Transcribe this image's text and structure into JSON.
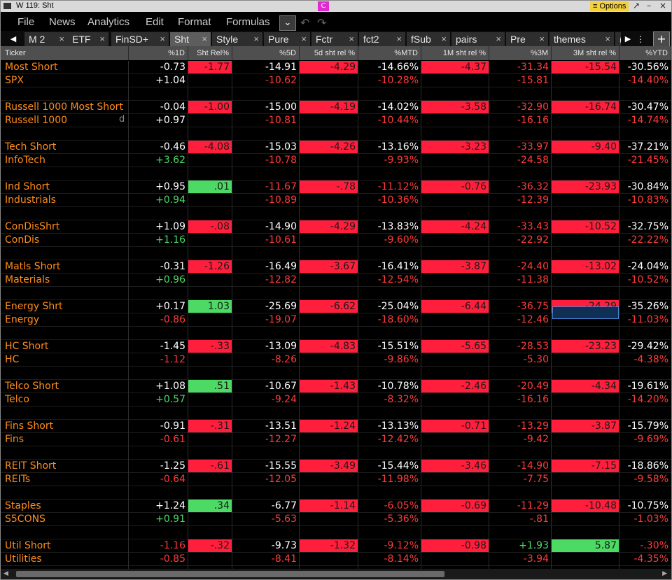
{
  "window": {
    "title": "W 119: Sht",
    "badge": "C",
    "options_label": "≡ Options",
    "minimize": "↗",
    "restore": "–",
    "close": "×"
  },
  "menu": [
    "File",
    "News",
    "Analytics",
    "Edit",
    "Format",
    "Formulas"
  ],
  "menu_overflow_icon": "double-chevron-down-icon",
  "tabs": [
    {
      "label": "M 2",
      "active": false
    },
    {
      "label": "ETF",
      "active": false
    },
    {
      "label": "FinSD+",
      "active": false
    },
    {
      "label": "Sht",
      "active": true
    },
    {
      "label": "Style",
      "active": false
    },
    {
      "label": "Pure",
      "active": false
    },
    {
      "label": "Fctr",
      "active": false
    },
    {
      "label": "fct2",
      "active": false
    },
    {
      "label": "fSub",
      "active": false
    },
    {
      "label": "pairs",
      "active": false
    },
    {
      "label": "Pre",
      "active": false
    },
    {
      "label": "themes",
      "active": false
    },
    {
      "label": "(",
      "active": false
    }
  ],
  "tab_close_glyph": "×",
  "tab_add_label": "+",
  "columns": [
    "Ticker",
    "%1D",
    "Sht Rel%",
    "%5D",
    "5d sht rel %",
    "%MTD",
    "1M sht rel %",
    "%3M",
    "3M sht rel %",
    "%YTD"
  ],
  "colors": {
    "orange": "#ff8c1a",
    "white": "#ffffff",
    "green_text": "#4cd964",
    "red_text": "#ff3b3b",
    "red_bg": "#ff1e3c",
    "green_bg": "#4cd964",
    "dark_text": "#1a1a1a"
  },
  "rows": [
    {
      "ticker": "Most Short",
      "c1": "-0.73",
      "c2": "-1.77",
      "c3": "-14.91",
      "c4": "-4.29",
      "c5": "-14.66%",
      "c6": "-4.37",
      "c7": "-31.34",
      "c8": "-15.54",
      "c9": "-30.56%",
      "style": "short"
    },
    {
      "ticker": "SPX",
      "c1": "+1.04",
      "c2": "",
      "c3": "-10.62",
      "c4": "",
      "c5": "-10.28%",
      "c6": "",
      "c7": "-15.81",
      "c8": "",
      "c9": "-14.40%",
      "style": "index"
    },
    {
      "ticker": "",
      "style": "blank"
    },
    {
      "ticker": "Russell 1000 Most Short",
      "c1": "-0.04",
      "c2": "-1.00",
      "c3": "-15.00",
      "c4": "-4.19",
      "c5": "-14.02%",
      "c6": "-3.58",
      "c7": "-32.90",
      "c8": "-16.74",
      "c9": "-30.47%",
      "style": "short"
    },
    {
      "ticker": "Russell 1000",
      "marker": "d",
      "c1": "+0.97",
      "c2": "",
      "c3": "-10.81",
      "c4": "",
      "c5": "-10.44%",
      "c6": "",
      "c7": "-16.16",
      "c8": "",
      "c9": "-14.74%",
      "style": "index"
    },
    {
      "ticker": "",
      "style": "blank"
    },
    {
      "ticker": "Tech Short",
      "c1": "-0.46",
      "c2": "-4.08",
      "c3": "-15.03",
      "c4": "-4.26",
      "c5": "-13.16%",
      "c6": "-3.23",
      "c7": "-33.97",
      "c8": "-9.40",
      "c9": "-37.21%",
      "style": "short"
    },
    {
      "ticker": "InfoTech",
      "c1": "+3.62",
      "c2": "",
      "c3": "-10.78",
      "c4": "",
      "c5": "-9.93%",
      "c6": "",
      "c7": "-24.58",
      "c8": "",
      "c9": "-21.45%",
      "style": "index"
    },
    {
      "ticker": "",
      "style": "blank"
    },
    {
      "ticker": "Ind Short",
      "c1": "+0.95",
      "c2": ".01",
      "c3": "-11.67",
      "c4": "-.78",
      "c5": "-11.12%",
      "c6": "-0.76",
      "c7": "-36.32",
      "c8": "-23.93",
      "c9": "-30.84%",
      "style": "short"
    },
    {
      "ticker": "Industrials",
      "c1": "+0.94",
      "c2": "",
      "c3": "-10.89",
      "c4": "",
      "c5": "-10.36%",
      "c6": "",
      "c7": "-12.39",
      "c8": "",
      "c9": "-10.83%",
      "style": "index"
    },
    {
      "ticker": "",
      "style": "blank"
    },
    {
      "ticker": "ConDisShrt",
      "c1": "+1.09",
      "c2": "-.08",
      "c3": "-14.90",
      "c4": "-4.29",
      "c5": "-13.83%",
      "c6": "-4.24",
      "c7": "-33.43",
      "c8": "-10.52",
      "c9": "-32.75%",
      "style": "short"
    },
    {
      "ticker": "ConDis",
      "c1": "+1.16",
      "c2": "",
      "c3": "-10.61",
      "c4": "",
      "c5": "-9.60%",
      "c6": "",
      "c7": "-22.92",
      "c8": "",
      "c9": "-22.22%",
      "style": "index"
    },
    {
      "ticker": "",
      "style": "blank"
    },
    {
      "ticker": "Matls Short",
      "c1": "-0.31",
      "c2": "-1.26",
      "c3": "-16.49",
      "c4": "-3.67",
      "c5": "-16.41%",
      "c6": "-3.87",
      "c7": "-24.40",
      "c8": "-13.02",
      "c9": "-24.04%",
      "style": "short"
    },
    {
      "ticker": "Materials",
      "c1": "+0.96",
      "c2": "",
      "c3": "-12.82",
      "c4": "",
      "c5": "-12.54%",
      "c6": "",
      "c7": "-11.38",
      "c8": "",
      "c9": "-10.52%",
      "style": "index"
    },
    {
      "ticker": "",
      "style": "blank"
    },
    {
      "ticker": "Energy Shrt",
      "c1": "+0.17",
      "c2": "1.03",
      "c3": "-25.69",
      "c4": "-6.62",
      "c5": "-25.04%",
      "c6": "-6.44",
      "c7": "-36.75",
      "c8": "-24.29",
      "c9": "-35.26%",
      "style": "short"
    },
    {
      "ticker": "Energy",
      "c1": "-0.86",
      "c2": "",
      "c3": "-19.07",
      "c4": "",
      "c5": "-18.60%",
      "c6": "",
      "c7": "-12.46",
      "c8": "",
      "c9": "-11.03%",
      "style": "index"
    },
    {
      "ticker": "",
      "style": "blank"
    },
    {
      "ticker": "HC Short",
      "c1": "-1.45",
      "c2": "-.33",
      "c3": "-13.09",
      "c4": "-4.83",
      "c5": "-15.51%",
      "c6": "-5.65",
      "c7": "-28.53",
      "c8": "-23.23",
      "c9": "-29.42%",
      "style": "short"
    },
    {
      "ticker": "HC",
      "c1": "-1.12",
      "c2": "",
      "c3": "-8.26",
      "c4": "",
      "c5": "-9.86%",
      "c6": "",
      "c7": "-5.30",
      "c8": "",
      "c9": "-4.38%",
      "style": "index"
    },
    {
      "ticker": "",
      "style": "blank"
    },
    {
      "ticker": "Telco Short",
      "c1": "+1.08",
      "c2": ".51",
      "c3": "-10.67",
      "c4": "-1.43",
      "c5": "-10.78%",
      "c6": "-2.46",
      "c7": "-20.49",
      "c8": "-4.34",
      "c9": "-19.61%",
      "style": "short"
    },
    {
      "ticker": "Telco",
      "c1": "+0.57",
      "c2": "",
      "c3": "-9.24",
      "c4": "",
      "c5": "-8.32%",
      "c6": "",
      "c7": "-16.16",
      "c8": "",
      "c9": "-14.20%",
      "style": "index"
    },
    {
      "ticker": "",
      "style": "blank"
    },
    {
      "ticker": "Fins Short",
      "c1": "-0.91",
      "c2": "-.31",
      "c3": "-13.51",
      "c4": "-1.24",
      "c5": "-13.13%",
      "c6": "-0.71",
      "c7": "-13.29",
      "c8": "-3.87",
      "c9": "-15.79%",
      "style": "short"
    },
    {
      "ticker": "Fins",
      "c1": "-0.61",
      "c2": "",
      "c3": "-12.27",
      "c4": "",
      "c5": "-12.42%",
      "c6": "",
      "c7": "-9.42",
      "c8": "",
      "c9": "-9.69%",
      "style": "index"
    },
    {
      "ticker": "",
      "style": "blank"
    },
    {
      "ticker": "REIT Short",
      "c1": "-1.25",
      "c2": "-.61",
      "c3": "-15.55",
      "c4": "-3.49",
      "c5": "-15.44%",
      "c6": "-3.46",
      "c7": "-14.90",
      "c8": "-7.15",
      "c9": "-18.86%",
      "style": "short"
    },
    {
      "ticker": "REITs",
      "c1": "-0.64",
      "c2": "",
      "c3": "-12.05",
      "c4": "",
      "c5": "-11.98%",
      "c6": "",
      "c7": "-7.75",
      "c8": "",
      "c9": "-9.58%",
      "style": "index"
    },
    {
      "ticker": "",
      "style": "blank"
    },
    {
      "ticker": "Staples",
      "c1": "+1.24",
      "c2": ".34",
      "c3": "-6.77",
      "c4": "-1.14",
      "c5": "-6.05%",
      "c6": "-0.69",
      "c7": "-11.29",
      "c8": "-10.48",
      "c9": "-10.75%",
      "style": "short"
    },
    {
      "ticker": "S5CONS",
      "c1": "+0.91",
      "c2": "",
      "c3": "-5.63",
      "c4": "",
      "c5": "-5.36%",
      "c6": "",
      "c7": "-.81",
      "c8": "",
      "c9": "-1.03%",
      "style": "index"
    },
    {
      "ticker": "",
      "style": "blank"
    },
    {
      "ticker": "Util Short",
      "c1": "-1.16",
      "c2": "-.32",
      "c3": "-9.73",
      "c4": "-1.32",
      "c5": "-9.12%",
      "c6": "-0.98",
      "c7": "+1.93",
      "c8": "5.87",
      "c9": "-.30%",
      "style": "short"
    },
    {
      "ticker": "Utilities",
      "c1": "-0.85",
      "c2": "",
      "c3": "-8.41",
      "c4": "",
      "c5": "-8.14%",
      "c6": "",
      "c7": "-3.94",
      "c8": "",
      "c9": "-4.35%",
      "style": "index"
    }
  ]
}
